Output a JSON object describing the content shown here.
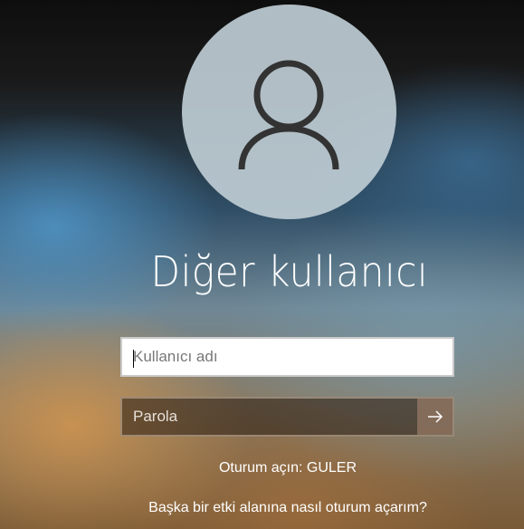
{
  "login": {
    "display_name": "Diğer kullanıcı",
    "username_placeholder": "Kullanıcı adı",
    "password_placeholder": "Parola",
    "submit_icon": "arrow-right-icon",
    "sign_in_to": "Oturum açın: GULER",
    "other_domain_link": "Başka bir etki alanına nasıl oturum açarım?"
  },
  "icons": {
    "avatar": "user-silhouette-icon"
  },
  "colors": {
    "username_field_bg": "#ffffff",
    "text": "#ffffff"
  }
}
